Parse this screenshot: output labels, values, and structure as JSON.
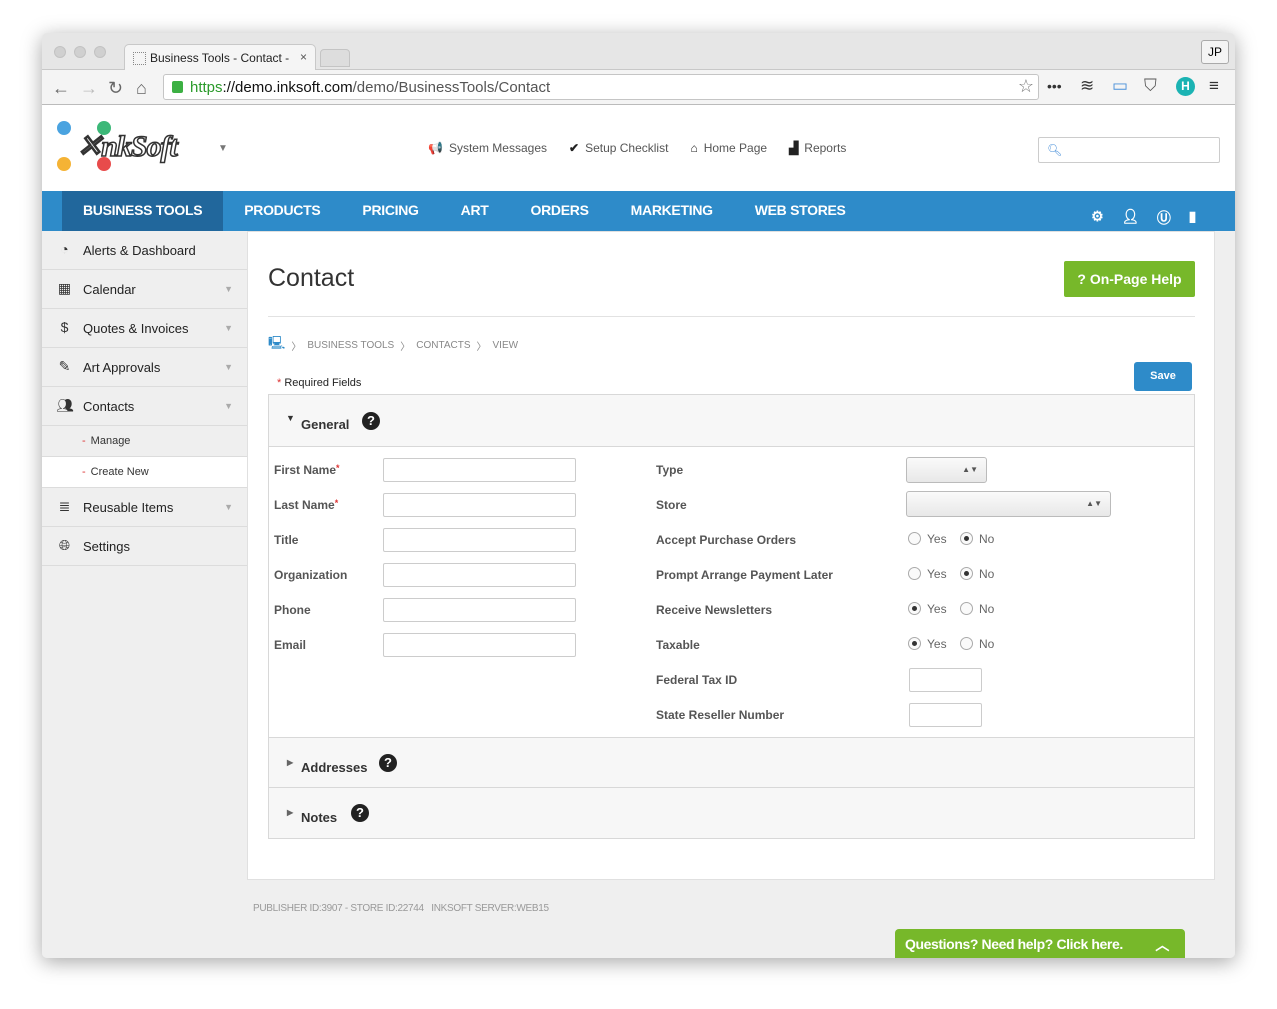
{
  "browser": {
    "tab_title": "Business Tools - Contact -",
    "url_scheme": "https",
    "url_host": "://demo.inksoft.com",
    "url_path": "/demo/BusinessTools/Contact",
    "profile": "JP"
  },
  "header": {
    "logo": "InkSoft",
    "links": [
      {
        "label": "System Messages",
        "icon": "megaphone-icon"
      },
      {
        "label": "Setup Checklist",
        "icon": "check-circle-icon"
      },
      {
        "label": "Home Page",
        "icon": "home-icon"
      },
      {
        "label": "Reports",
        "icon": "bar-chart-icon"
      }
    ],
    "search_placeholder": ""
  },
  "nav": {
    "items": [
      "BUSINESS TOOLS",
      "PRODUCTS",
      "PRICING",
      "ART",
      "ORDERS",
      "MARKETING",
      "WEB STORES"
    ],
    "active": "BUSINESS TOOLS",
    "icons": [
      "gear-icon",
      "user-icon",
      "u-icon",
      "book-icon"
    ]
  },
  "sidebar": {
    "items": [
      {
        "label": "Alerts & Dashboard"
      },
      {
        "label": "Calendar"
      },
      {
        "label": "Quotes & Invoices"
      },
      {
        "label": "Art Approvals"
      },
      {
        "label": "Contacts"
      }
    ],
    "sub_items": [
      "Manage",
      "Create New"
    ],
    "items_after": [
      {
        "label": "Reusable Items"
      },
      {
        "label": "Settings"
      }
    ]
  },
  "main": {
    "title": "Contact",
    "help_label": "? On-Page Help",
    "breadcrumb": [
      "BUSINESS TOOLS",
      "CONTACTS",
      "VIEW"
    ],
    "required_note": "Required Fields",
    "save_label": "Save",
    "general": {
      "title": "General",
      "left_fields": [
        {
          "label": "First Name",
          "required": true,
          "value": ""
        },
        {
          "label": "Last Name",
          "required": true,
          "value": ""
        },
        {
          "label": "Title",
          "value": ""
        },
        {
          "label": "Organization",
          "value": ""
        },
        {
          "label": "Phone",
          "value": ""
        },
        {
          "label": "Email",
          "value": ""
        }
      ],
      "type_label": "Type",
      "type_value": "",
      "store_label": "Store",
      "store_value": "",
      "radios": [
        {
          "label": "Accept Purchase Orders",
          "value": "No"
        },
        {
          "label": "Prompt Arrange Payment Later",
          "value": "No"
        },
        {
          "label": "Receive Newsletters",
          "value": "Yes"
        },
        {
          "label": "Taxable",
          "value": "Yes"
        }
      ],
      "yes": "Yes",
      "no": "No",
      "federal_tax_label": "Federal Tax ID",
      "federal_tax_value": "",
      "reseller_label": "State Reseller Number",
      "reseller_value": ""
    },
    "addresses_title": "Addresses",
    "notes_title": "Notes"
  },
  "footer": {
    "text": "PUBLISHER ID:3907 - STORE ID:22744   INKSOFT SERVER:WEB15"
  },
  "chat": {
    "label": "Questions? Need help? Click here."
  },
  "colors": {
    "nav": "#2e8bc9",
    "nav_active": "#21679c",
    "green": "#77b82a"
  }
}
